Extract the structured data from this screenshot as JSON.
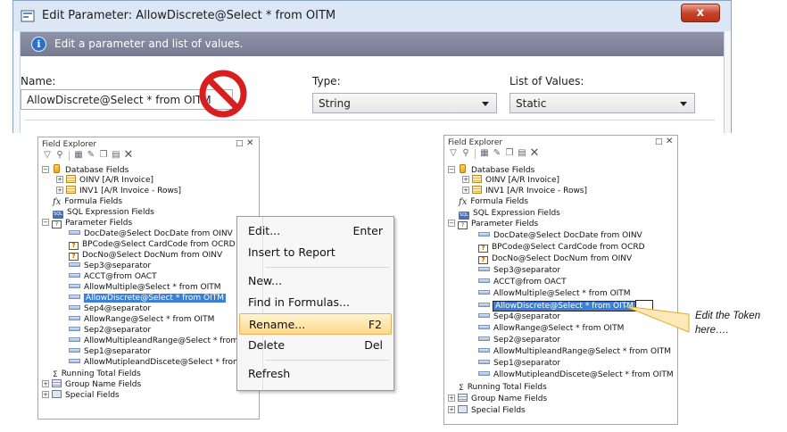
{
  "dialog": {
    "title": "Edit Parameter: AllowDiscrete@Select * from OITM",
    "close_label": "x",
    "info_text": "Edit a parameter and list of values.",
    "name_label": "Name:",
    "name_value": "AllowDiscrete@Select * from OITM",
    "type_label": "Type:",
    "type_value": "String",
    "lov_label": "List of Values:",
    "lov_value": "Static"
  },
  "left_explorer": {
    "title": "Field Explorer",
    "pin": "□",
    "close": "✕",
    "tree": {
      "database_fields": "Database Fields",
      "oinv": "OINV [A/R Invoice]",
      "inv1": "INV1 [A/R Invoice - Rows]",
      "formula_fields": "Formula Fields",
      "sql_fields": "SQL Expression Fields",
      "parameter_fields": "Parameter Fields",
      "params": [
        "DocDate@Select DocDate from OINV",
        "BPCode@Select CardCode from OCRD",
        "DocNo@Select DocNum from OINV",
        "Sep3@separator",
        "ACCT@from OACT",
        "AllowMultiple@Select * from OITM",
        "AllowDiscrete@Select * from OITM",
        "Sep4@separator",
        "AllowRange@Select * from OITM",
        "Sep2@separator",
        "AllowMultipleandRange@Select * from OITM",
        "Sep1@separator",
        "AllowMutipleandDiscete@Select * from OITM"
      ],
      "running_total": "Running Total Fields",
      "group_name": "Group Name Fields",
      "special": "Special Fields"
    }
  },
  "context_menu": {
    "items": [
      {
        "label": "Edit...",
        "key": "Enter"
      },
      {
        "label": "Insert to Report",
        "key": ""
      },
      {
        "label": "New...",
        "key": ""
      },
      {
        "label": "Find in Formulas...",
        "key": ""
      },
      {
        "label": "Rename...",
        "key": "F2"
      },
      {
        "label": "Delete",
        "key": "Del"
      },
      {
        "label": "Refresh",
        "key": ""
      }
    ]
  },
  "right_explorer": {
    "title": "Field Explorer",
    "pin": "□",
    "close": "✕",
    "tree": {
      "database_fields": "Database Fields",
      "oinv": "OINV [A/R Invoice]",
      "inv1": "INV1 [A/R Invoice - Rows]",
      "formula_fields": "Formula Fields",
      "sql_fields": "SQL Expression Fields",
      "parameter_fields": "Parameter Fields",
      "params": [
        "DocDate@Select DocDate from OINV",
        "BPCode@Select CardCode from OCRD",
        "DocNo@Select DocNum from OINV",
        "Sep3@separator",
        "ACCT@from OACT",
        "AllowMultiple@Select * from OITM",
        "AllowDiscrete@Select * from OITM",
        "Sep4@separator",
        "AllowRange@Select * from OITM",
        "Sep2@separator",
        "AllowMultipleandRange@Select * from OITM",
        "Sep1@separator",
        "AllowMutipleandDiscete@Select * from OITM"
      ],
      "running_total": "Running Total Fields",
      "group_name": "Group Name Fields",
      "special": "Special Fields"
    }
  },
  "callout": {
    "line1": "Edit the Token",
    "line2": "here…."
  },
  "colors": {
    "selection": "#3d7fd6",
    "menu_highlight": "#fcd98a",
    "callout_fill": "#fde9b8",
    "callout_stroke": "#e8a82a",
    "no_sign": "#d81e1e"
  }
}
